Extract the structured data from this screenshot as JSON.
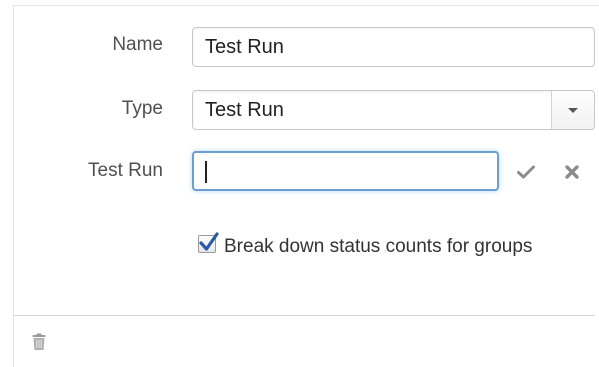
{
  "form": {
    "name_label": "Name",
    "name_value": "Test Run",
    "type_label": "Type",
    "type_selected": "Test Run",
    "testrun_label": "Test Run",
    "testrun_value": ""
  },
  "actions": {
    "confirm_icon": "check-icon",
    "cancel_icon": "close-icon"
  },
  "options": {
    "breakdown_checked": true,
    "breakdown_label": "Break down status counts for groups"
  },
  "footer": {
    "delete_icon": "trash-icon"
  },
  "colors": {
    "focus_border": "#6a9fd0",
    "label_text": "#505050",
    "checkmark": "#2a5aa6"
  }
}
